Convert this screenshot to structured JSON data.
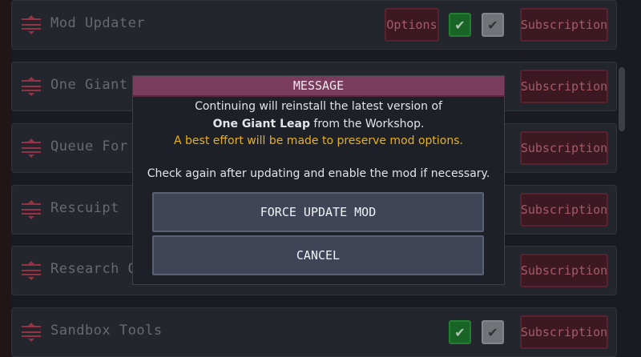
{
  "mods": [
    {
      "name": "Mod Updater",
      "has_options": true,
      "enabled": true,
      "subscription_label": "Subscription",
      "options_label": "Options"
    },
    {
      "name": "One Giant Lea",
      "has_options": false,
      "enabled": true,
      "subscription_label": "Subscription"
    },
    {
      "name": "Queue For Sin",
      "has_options": false,
      "enabled": true,
      "subscription_label": "Subscription"
    },
    {
      "name": "Rescuipt",
      "has_options": false,
      "enabled": true,
      "subscription_label": "Subscription"
    },
    {
      "name": "Research Que",
      "has_options": false,
      "enabled": true,
      "subscription_label": "Subscription"
    },
    {
      "name": "Sandbox Tools",
      "has_options": false,
      "enabled": true,
      "subscription_label": "Subscription"
    }
  ],
  "dialog": {
    "title": "MESSAGE",
    "line1": "Continuing will reinstall the latest version of",
    "line2_bold": "One Giant Leap",
    "line2_rest": " from the Workshop.",
    "warning": "A best effort will be made to preserve mod options.",
    "line4": "Check again after updating and enable the mod if necessary.",
    "force_update_label": "FORCE UPDATE MOD",
    "cancel_label": "CANCEL"
  },
  "icons": {
    "check": "✔",
    "drag_handle": "drag-handle-icon"
  },
  "colors": {
    "accent": "#b83d55",
    "header": "#7a3c5c",
    "warning": "#e6b11e",
    "enabled_green": "#1e7a2c"
  }
}
